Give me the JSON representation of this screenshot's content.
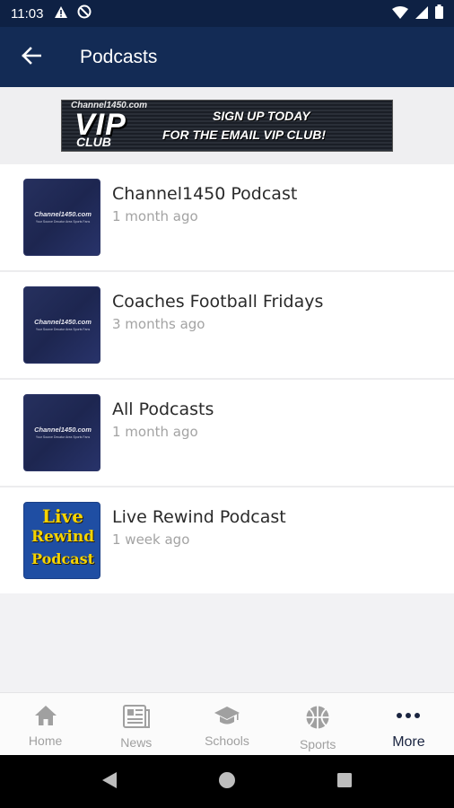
{
  "status_bar": {
    "time": "11:03",
    "left_icons": [
      "warning-icon",
      "no-sim-icon"
    ],
    "right_icons": [
      "wifi-icon",
      "signal-icon",
      "battery-icon"
    ]
  },
  "app_bar": {
    "back_icon": "arrow-left-icon",
    "title": "Podcasts"
  },
  "banner": {
    "brand": "Channel1450.com",
    "vip": "VIP",
    "club": "CLUB",
    "cta_line1": "SIGN UP TODAY",
    "cta_line2": "FOR THE EMAIL VIP CLUB!"
  },
  "podcasts": [
    {
      "title": "Channel1450 Podcast",
      "updated": "1 month ago",
      "thumb_text": "Channel1450.com",
      "thumb_sub": "Your Source Decatur Area Sports Fans"
    },
    {
      "title": "Coaches Football Fridays",
      "updated": "3 months ago",
      "thumb_text": "Channel1450.com",
      "thumb_sub": "Your Source Decatur Area Sports Fans"
    },
    {
      "title": "All Podcasts",
      "updated": "1 month ago",
      "thumb_text": "Channel1450.com",
      "thumb_sub": "Your Source Decatur Area Sports Fans"
    },
    {
      "title": "Live Rewind Podcast",
      "updated": "1 week ago",
      "thumb_lines": [
        "Live",
        "Rewind",
        "Podcast"
      ]
    }
  ],
  "bottom_nav": [
    {
      "label": "Home",
      "icon": "home-icon",
      "active": false
    },
    {
      "label": "News",
      "icon": "newspaper-icon",
      "active": false
    },
    {
      "label": "Schools",
      "icon": "graduation-cap-icon",
      "active": false
    },
    {
      "label": "Sports",
      "icon": "basketball-icon",
      "active": false
    },
    {
      "label": "More",
      "icon": "more-dots-icon",
      "active": true
    }
  ],
  "colors": {
    "status_bar": "#0e2144",
    "app_bar": "#132b55",
    "active_tab": "#1a2440",
    "inactive_tab": "#a0a0a0",
    "live_yellow": "#f5d400"
  }
}
